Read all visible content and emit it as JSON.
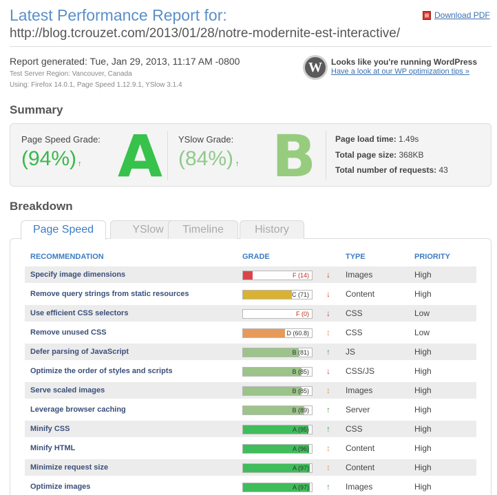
{
  "header": {
    "title": "Latest Performance Report for:",
    "url": "http://blog.tcrouzet.com/2013/01/28/notre-modernite-est-interactive/",
    "pdf_label": "Download PDF"
  },
  "report": {
    "generated": "Report generated:  Tue, Jan 29, 2013, 11:17 AM -0800",
    "region": "Test Server Region: Vancouver, Canada",
    "using": "Using: Firefox 14.0.1, Page Speed 1.12.9.1, YSlow 3.1.4"
  },
  "wordpress": {
    "logo": "W",
    "title": "Looks like you're running WordPress",
    "link": "Have a look at our WP optimization tips »"
  },
  "summary": {
    "heading": "Summary",
    "pagespeed_label": "Page Speed Grade:",
    "pagespeed_value": "(94%)",
    "pagespeed_letter": "A",
    "yslow_label": "YSlow Grade:",
    "yslow_value": "(84%)",
    "yslow_letter": "B",
    "trend_up": "↑",
    "load_time_label": "Page load time:",
    "load_time_value": "1.49s",
    "size_label": "Total page size:",
    "size_value": "368KB",
    "requests_label": "Total number of requests:",
    "requests_value": "43"
  },
  "breakdown": {
    "heading": "Breakdown",
    "tabs": [
      "Page Speed",
      "YSlow",
      "Timeline",
      "History"
    ],
    "active_tab": "Page Speed",
    "columns": {
      "recommendation": "RECOMMENDATION",
      "grade": "GRADE",
      "type": "TYPE",
      "priority": "PRIORITY"
    },
    "rows": [
      {
        "rec": "Specify image dimensions",
        "grade_label": "F (14)",
        "score": 14,
        "color": "#d9464a",
        "arrow": "↓",
        "trend": "down",
        "type": "Images",
        "priority": "High"
      },
      {
        "rec": "Remove query strings from static resources",
        "grade_label": "C (71)",
        "score": 71,
        "color": "#d9b232",
        "arrow": "↓",
        "trend": "down",
        "type": "Content",
        "priority": "High"
      },
      {
        "rec": "Use efficient CSS selectors",
        "grade_label": "F (0)",
        "score": 0,
        "color": "#d9464a",
        "arrow": "↓",
        "trend": "down",
        "type": "CSS",
        "priority": "Low"
      },
      {
        "rec": "Remove unused CSS",
        "grade_label": "D (60.8)",
        "score": 60.8,
        "color": "#e89a5a",
        "arrow": "↕",
        "trend": "neutral",
        "type": "CSS",
        "priority": "Low"
      },
      {
        "rec": "Defer parsing of JavaScript",
        "grade_label": "B (81)",
        "score": 81,
        "color": "#9cc48a",
        "arrow": "↑",
        "trend": "up",
        "type": "JS",
        "priority": "High"
      },
      {
        "rec": "Optimize the order of styles and scripts",
        "grade_label": "B (85)",
        "score": 85,
        "color": "#9cc48a",
        "arrow": "↓",
        "trend": "down",
        "type": "CSS/JS",
        "priority": "High"
      },
      {
        "rec": "Serve scaled images",
        "grade_label": "B (85)",
        "score": 85,
        "color": "#9cc48a",
        "arrow": "↕",
        "trend": "neutral",
        "type": "Images",
        "priority": "High"
      },
      {
        "rec": "Leverage browser caching",
        "grade_label": "B (89)",
        "score": 89,
        "color": "#9cc48a",
        "arrow": "↑",
        "trend": "up",
        "type": "Server",
        "priority": "High"
      },
      {
        "rec": "Minify CSS",
        "grade_label": "A (95)",
        "score": 95,
        "color": "#3fbd5a",
        "arrow": "↑",
        "trend": "up",
        "type": "CSS",
        "priority": "High"
      },
      {
        "rec": "Minify HTML",
        "grade_label": "A (96)",
        "score": 96,
        "color": "#3fbd5a",
        "arrow": "↕",
        "trend": "neutral",
        "type": "Content",
        "priority": "High"
      },
      {
        "rec": "Minimize request size",
        "grade_label": "A (97)",
        "score": 97,
        "color": "#3fbd5a",
        "arrow": "↕",
        "trend": "neutral",
        "type": "Content",
        "priority": "High"
      },
      {
        "rec": "Optimize images",
        "grade_label": "A (97)",
        "score": 97,
        "color": "#3fbd5a",
        "arrow": "↑",
        "trend": "up",
        "type": "Images",
        "priority": "High"
      }
    ]
  }
}
